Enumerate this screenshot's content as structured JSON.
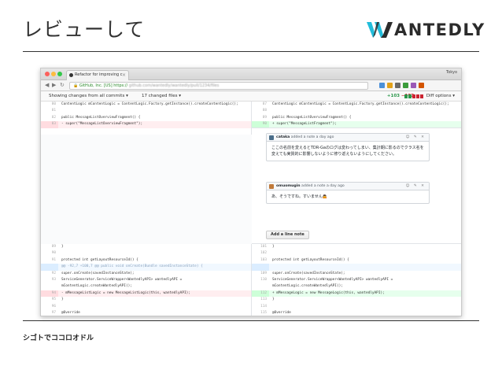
{
  "slide": {
    "title": "レビューして",
    "logo_text": "ANTEDLY",
    "footer": "シゴトでココロオドル",
    "colors": {
      "logo_teal": "#21bddb",
      "logo_dark": "#2b2b2b"
    }
  },
  "browser": {
    "tab_title": "Refactor for improving c",
    "tab_close": "×",
    "profile": "Tokyo",
    "url_secure": "GitHub, Inc. [US]",
    "url_scheme": "https://",
    "url_rest": "github.com/wantedly/wantedly/pull/1234/files",
    "nav_back": "◀",
    "nav_forward": "▶",
    "nav_reload": "↻",
    "extension_colors": [
      "#4a90d9",
      "#e3a21a",
      "#6a6a6a",
      "#3b9c3b",
      "#9b59b6",
      "#d35400"
    ]
  },
  "toolbar": {
    "showing": "Showing changes from all commits ▾",
    "changed": "17 changed files ▾",
    "additions": "+103",
    "deletions": "−107",
    "diff_options": "Diff options ▾",
    "bar_colors": [
      "#2c974b",
      "#2c974b",
      "#cb2431",
      "#cb2431",
      "#cb2431"
    ]
  },
  "diff_top": {
    "left": [
      {
        "n": "80",
        "t": "",
        "code": "ContentLogic mContentLogic = ContentLogic.Factory.getInstance().createContentLogic();"
      },
      {
        "n": "81",
        "t": "",
        "code": ""
      },
      {
        "n": "82",
        "t": "",
        "code": "public MessageListOverviewFragment() {"
      },
      {
        "n": "83",
        "t": "del",
        "code": "-    super(\"MessageListOverviewFragment\");"
      }
    ],
    "right": [
      {
        "n": "87",
        "t": "",
        "code": "ContentLogic mContentLogic = ContentLogic.Factory.getInstance().createContentLogic();"
      },
      {
        "n": "88",
        "t": "",
        "code": ""
      },
      {
        "n": "89",
        "t": "",
        "code": "public MessageListOverviewFragment() {"
      },
      {
        "n": "90",
        "t": "add",
        "code": "+    super(\"MessageListFragment\");"
      }
    ]
  },
  "comments": [
    {
      "user": "cataka",
      "meta": "added a note a day ago",
      "icons": "☺ ✎ ✕",
      "body": "ここの名前を変えるとTDR-Gaのログは変わってしまい、集計期に影るのでクラス名を変えても実質的に影響しないように修り返えないようにしてください。",
      "avatar_color": "#4a6e8a"
    },
    {
      "user": "omuomugin",
      "meta": "added a note a day ago",
      "icons": "☺ ✎ ✕",
      "body": "あ、そうですね。すいません🙇",
      "avatar_color": "#c07a3a"
    }
  ],
  "add_note_label": "Add a line note",
  "diff_bottom": {
    "left": [
      {
        "n": "89",
        "t": "",
        "code": "}"
      },
      {
        "n": "90",
        "t": "",
        "code": ""
      },
      {
        "n": "91",
        "t": "",
        "code": "protected int getLayoutResourceId() {"
      },
      {
        "n": "",
        "t": "hunk",
        "code": "@@ -92,7 +100,7 @@ public void onCreate(Bundle savedInstanceState) {"
      },
      {
        "n": "92",
        "t": "",
        "code": "super.onCreate(savedInstanceState);"
      },
      {
        "n": "93",
        "t": "",
        "code": "ServiceGenerator.ServiceWrapper<WantedlyAPI> wantedlyAPI ="
      },
      {
        "n": "",
        "t": "",
        "code": "mContentLogic.createWantedlyAPI();"
      },
      {
        "n": "94",
        "t": "del",
        "code": "-    mMessageListLogic = new MessageListLogic(this, wantedlyAPI);"
      },
      {
        "n": "95",
        "t": "",
        "code": "}"
      },
      {
        "n": "96",
        "t": "",
        "code": ""
      },
      {
        "n": "97",
        "t": "",
        "code": "@Override"
      },
      {
        "n": "",
        "t": "hunk",
        "code": "@@ -136,11 +142,9 @@ protected void subOnSuccess(List<Item> items, boolean isFirstRequest) {"
      },
      {
        "n": "136",
        "t": "",
        "code": "adapter.getItems().addAll(items);"
      },
      {
        "n": "137",
        "t": "",
        "code": "adapter.notifyItemRangeInserted(0, items.size());"
      },
      {
        "n": "138",
        "t": "",
        "code": ""
      },
      {
        "n": "139",
        "t": "del",
        "code": "-    mMessageListLogic.reset(adapter);"
      },
      {
        "n": "140",
        "t": "",
        "code": "executeRequestForArchiveMessage();"
      }
    ],
    "right": [
      {
        "n": "101",
        "t": "",
        "code": "}"
      },
      {
        "n": "102",
        "t": "",
        "code": ""
      },
      {
        "n": "103",
        "t": "",
        "code": "protected int getLayoutResourceId() {"
      },
      {
        "n": "",
        "t": "hunk",
        "code": ""
      },
      {
        "n": "109",
        "t": "",
        "code": "super.onCreate(savedInstanceState);"
      },
      {
        "n": "110",
        "t": "",
        "code": "ServiceGenerator.ServiceWrapper<WantedlyAPI> wantedlyAPI ="
      },
      {
        "n": "",
        "t": "",
        "code": "mContentLogic.createWantedlyAPI();"
      },
      {
        "n": "112",
        "t": "add",
        "code": "+    mMessageLogic = new MessageLogic(this, wantedlyAPI);"
      },
      {
        "n": "113",
        "t": "",
        "code": "}"
      },
      {
        "n": "114",
        "t": "",
        "code": ""
      },
      {
        "n": "115",
        "t": "",
        "code": "@Override"
      },
      {
        "n": "",
        "t": "hunk",
        "code": ""
      },
      {
        "n": "154",
        "t": "",
        "code": "adapter.getItems().addAll(items);"
      },
      {
        "n": "155",
        "t": "",
        "code": "adapter.notifyItemRangeInserted(0, items.size());"
      },
      {
        "n": "156",
        "t": "",
        "code": ""
      },
      {
        "n": "157",
        "t": "add",
        "code": "+    resetData();"
      },
      {
        "n": "158",
        "t": "",
        "code": "executeRequestForArchiveMessage();"
      }
    ]
  }
}
